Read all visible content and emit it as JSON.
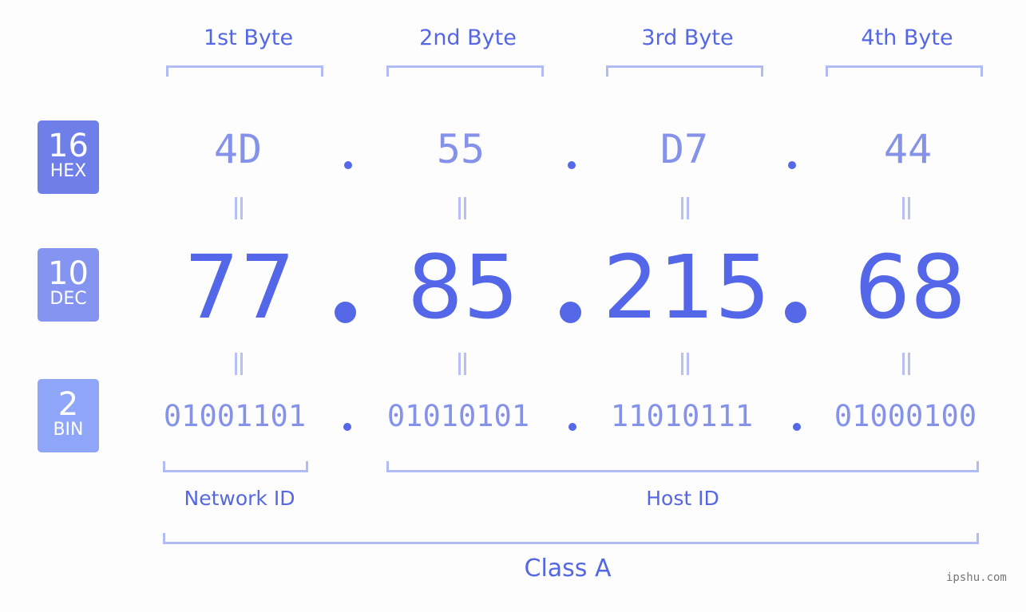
{
  "bytes": {
    "headers": [
      "1st Byte",
      "2nd Byte",
      "3rd Byte",
      "4th Byte"
    ]
  },
  "rows": {
    "hex": {
      "base": "16",
      "label": "HEX",
      "values": [
        "4D",
        "55",
        "D7",
        "44"
      ],
      "color": "#6f7fea"
    },
    "dec": {
      "base": "10",
      "label": "DEC",
      "values": [
        "77",
        "85",
        "215",
        "68"
      ],
      "color": "#8494f0"
    },
    "bin": {
      "base": "2",
      "label": "BIN",
      "values": [
        "01001101",
        "01010101",
        "11010111",
        "01000100"
      ],
      "color": "#8fa6f8"
    }
  },
  "segments": {
    "network": "Network ID",
    "host": "Host ID",
    "class": "Class A"
  },
  "watermark": "ipshu.com",
  "colors": {
    "accent": "#5467e8",
    "bracket": "#b1bcf7"
  }
}
